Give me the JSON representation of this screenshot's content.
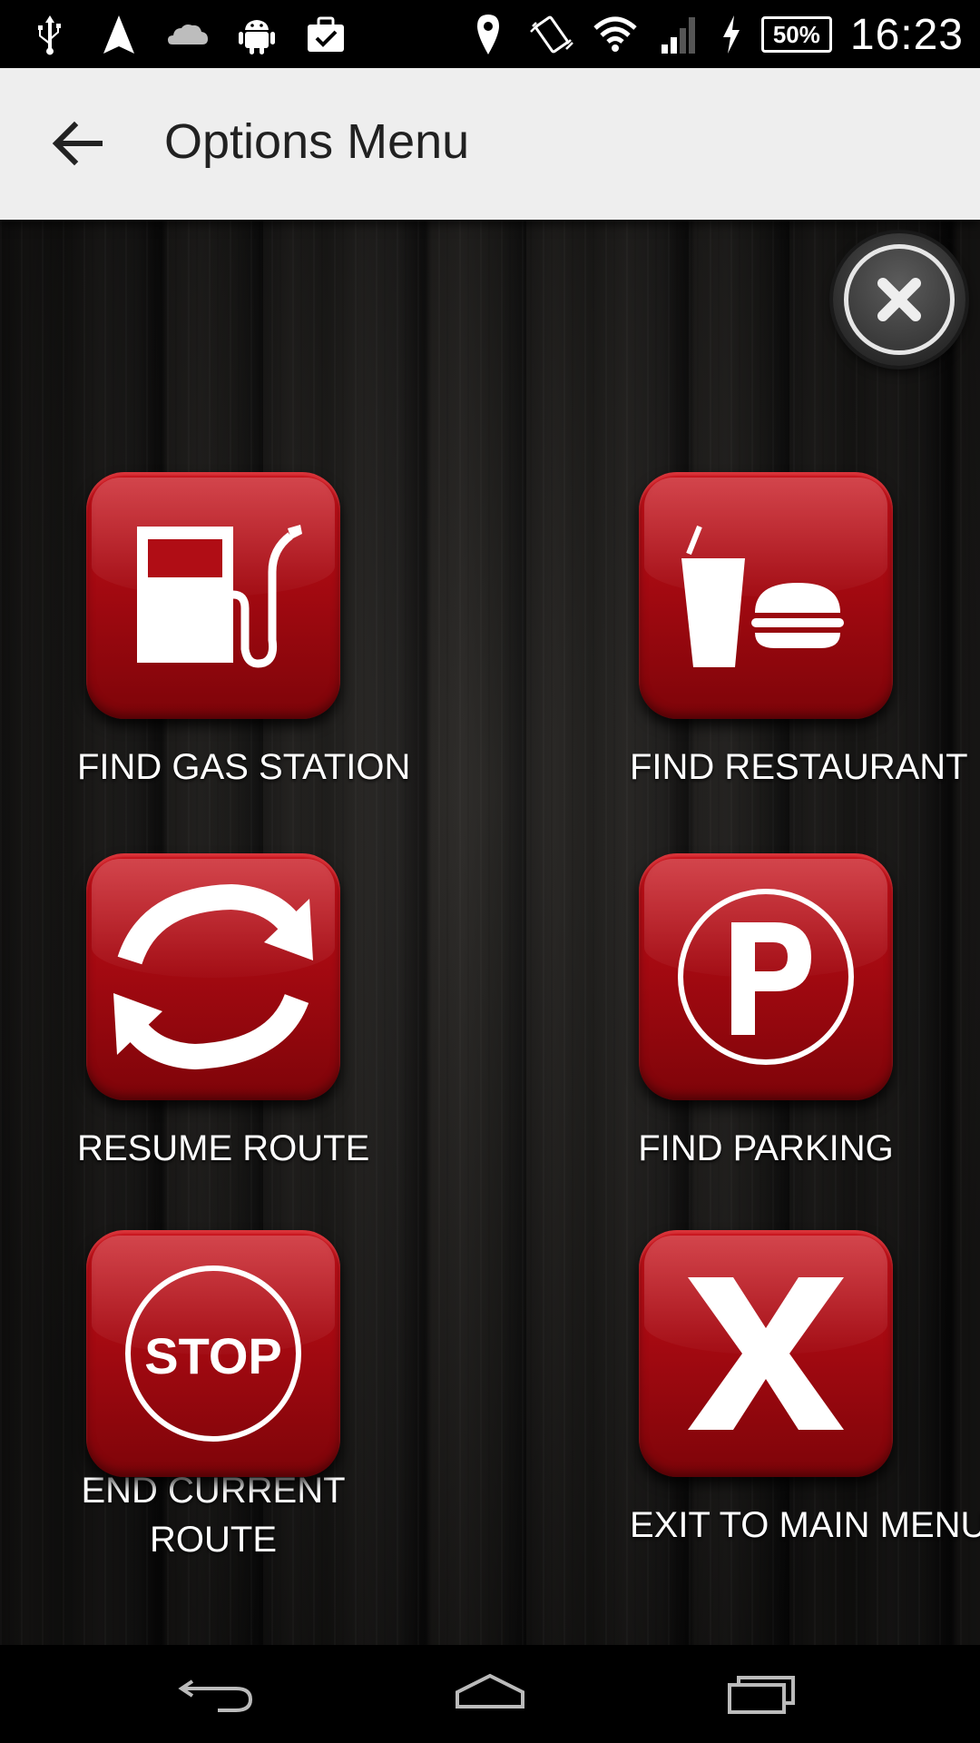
{
  "status_bar": {
    "battery": "50%",
    "time": "16:23",
    "icons": [
      "usb-icon",
      "navigation-icon",
      "cloud-icon",
      "android-icon",
      "briefcase-check-icon",
      "location-pin-icon",
      "vibrate-icon",
      "wifi-icon",
      "signal-icon",
      "charging-icon",
      "battery-icon"
    ]
  },
  "app_bar": {
    "title": "Options Menu",
    "back_icon": "arrow-back-icon"
  },
  "menu": {
    "close_icon": "close-icon",
    "items": [
      {
        "label": "FIND GAS STATION",
        "icon": "gas-pump-icon"
      },
      {
        "label": "FIND RESTAURANT",
        "icon": "restaurant-icon"
      },
      {
        "label": "RESUME ROUTE",
        "icon": "refresh-icon"
      },
      {
        "label": "FIND PARKING",
        "icon": "parking-icon"
      },
      {
        "label": "END CURRENT ROUTE",
        "icon": "stop-sign-icon",
        "sign_text": "STOP"
      },
      {
        "label": "EXIT TO MAIN MENU",
        "icon": "x-icon"
      }
    ]
  },
  "colors": {
    "button_red": "#b30d15",
    "app_bar_bg": "#eeeeee",
    "title_text": "#212121"
  },
  "nav_bar": {
    "icons": [
      "nav-back-icon",
      "nav-home-icon",
      "nav-recents-icon"
    ]
  }
}
